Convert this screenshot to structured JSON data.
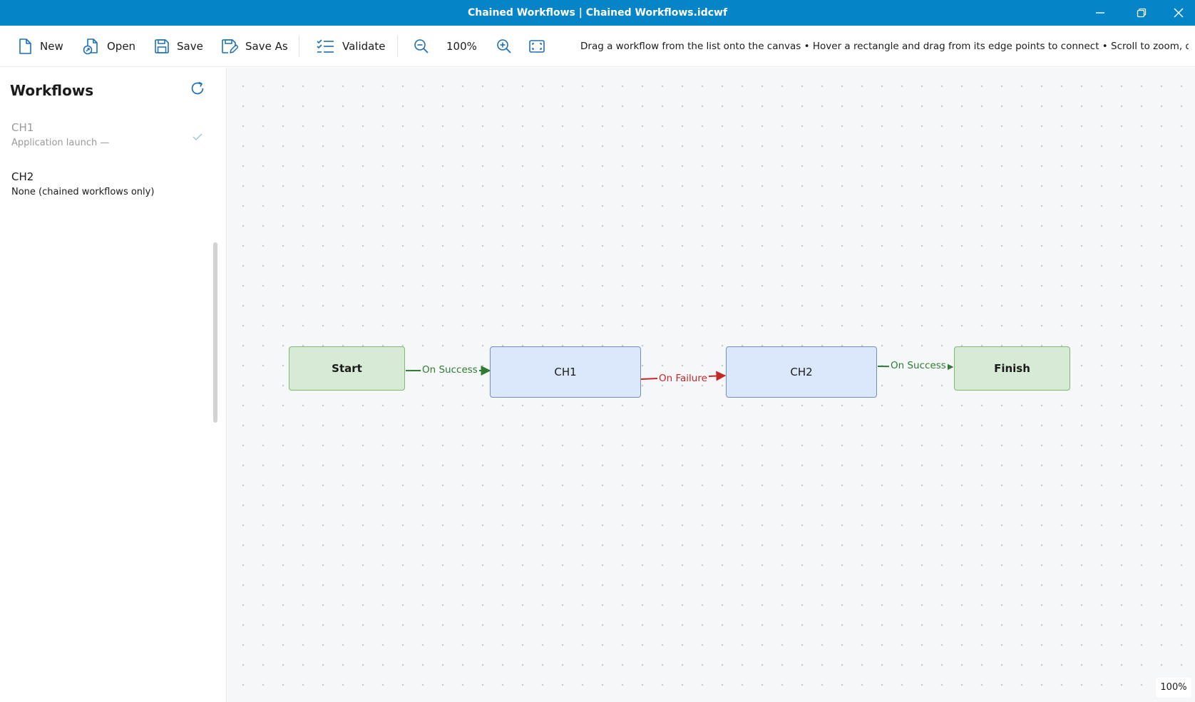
{
  "window": {
    "title": "Chained Workflows | Chained Workflows.idcwf"
  },
  "toolbar": {
    "new_label": "New",
    "open_label": "Open",
    "save_label": "Save",
    "save_as_label": "Save As",
    "validate_label": "Validate",
    "zoom_level": "100%",
    "hint": "Drag a workflow from the list onto the canvas • Hover a rectangle and drag from its edge points to connect • Scroll to zoom, drag the back..."
  },
  "sidebar": {
    "title": "Workflows",
    "items": [
      {
        "name": "CH1",
        "description": "Application launch —",
        "state": "added"
      },
      {
        "name": "CH2",
        "description": "None (chained workflows only)",
        "state": "available"
      }
    ]
  },
  "canvas": {
    "nodes": [
      {
        "id": "start",
        "label": "Start",
        "kind": "terminal"
      },
      {
        "id": "ch1",
        "label": "CH1",
        "kind": "workflow"
      },
      {
        "id": "ch2",
        "label": "CH2",
        "kind": "workflow"
      },
      {
        "id": "finish",
        "label": "Finish",
        "kind": "terminal"
      }
    ],
    "edges": [
      {
        "from": "start",
        "to": "ch1",
        "label": "On Success",
        "color": "#2e7d32"
      },
      {
        "from": "ch1",
        "to": "ch2",
        "label": "On Failure",
        "color": "#c62828"
      },
      {
        "from": "ch2",
        "to": "finish",
        "label": "On Success",
        "color": "#2e7d32"
      }
    ],
    "zoom_badge": "100%"
  },
  "colors": {
    "accent": "#0584c7",
    "success": "#2e7d32",
    "failure": "#c62828"
  }
}
